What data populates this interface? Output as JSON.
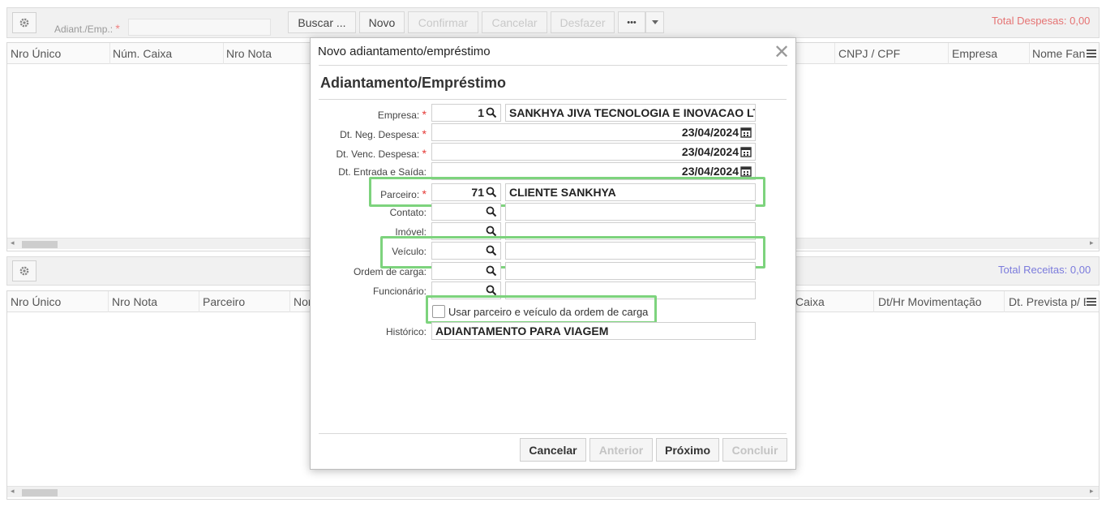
{
  "top": {
    "adiant_label": "Adiant./Emp.:",
    "required_mark": "*",
    "buttons": {
      "buscar": "Buscar ...",
      "novo": "Novo",
      "confirmar": "Confirmar",
      "cancelar": "Cancelar",
      "desfazer": "Desfazer",
      "more": "•••"
    },
    "total_despesas": "Total Despesas: 0,00",
    "columns": [
      "Nro Único",
      "Núm. Caixa",
      "Nro Nota",
      "CNPJ / CPF",
      "Empresa",
      "Nome Fan"
    ]
  },
  "bottom": {
    "total_receitas": "Total Receitas: 0,00",
    "columns": [
      "Nro Único",
      "Nro Nota",
      "Parceiro",
      "Nor",
      "Caixa",
      "Dt/Hr Movimentação",
      "Dt. Prevista p/ E"
    ]
  },
  "colors": {
    "despesas": "#e57373",
    "receitas": "#7b7bdc",
    "highlight": "#7dd37d",
    "required": "#e53935"
  },
  "modal": {
    "title": "Novo adiantamento/empréstimo",
    "section": "Adiantamento/Empréstimo",
    "fields": {
      "empresa": {
        "label": "Empresa:",
        "code": "1",
        "name": "SANKHYA JIVA TECNOLOGIA E INOVACAO LTDA"
      },
      "dt_neg": {
        "label": "Dt. Neg. Despesa:",
        "value": "23/04/2024"
      },
      "dt_venc": {
        "label": "Dt. Venc. Despesa:",
        "value": "23/04/2024"
      },
      "dt_entrada": {
        "label": "Dt. Entrada e Saída:",
        "value": "23/04/2024"
      },
      "parceiro": {
        "label": "Parceiro:",
        "code": "71",
        "name": "CLIENTE SANKHYA"
      },
      "contato": {
        "label": "Contato:"
      },
      "imovel": {
        "label": "Imóvel:"
      },
      "veiculo": {
        "label": "Veículo:"
      },
      "ordem_carga": {
        "label": "Ordem de carga:"
      },
      "funcionario": {
        "label": "Funcionário:"
      },
      "usar_parceiro": {
        "label": "Usar parceiro e veículo da ordem de carga",
        "checked": false
      },
      "historico": {
        "label": "Histórico:",
        "value": "ADIANTAMENTO PARA VIAGEM"
      }
    },
    "buttons": {
      "cancelar": "Cancelar",
      "anterior": "Anterior",
      "proximo": "Próximo",
      "concluir": "Concluir"
    }
  }
}
